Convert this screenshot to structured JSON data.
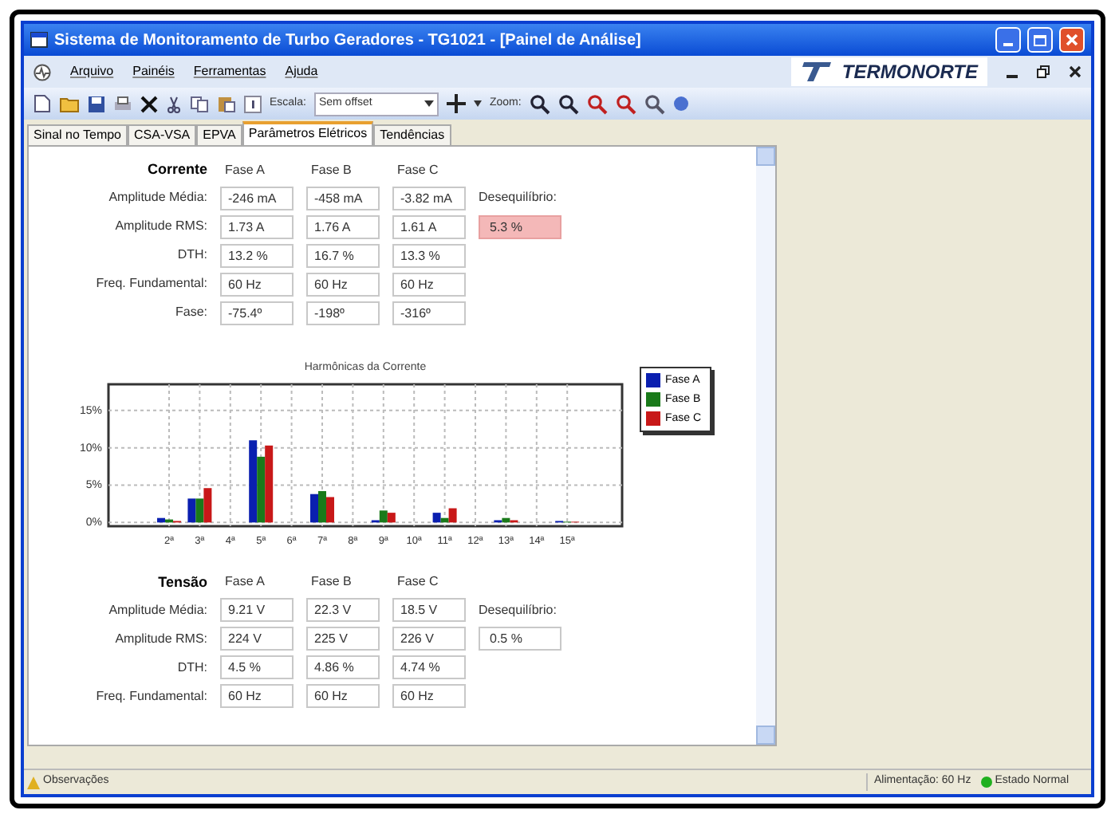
{
  "window": {
    "title": "Sistema de Monitoramento de Turbo Geradores - TG1021 - [Painel de Análise]"
  },
  "menu": [
    "Arquivo",
    "Painéis",
    "Ferramentas",
    "Ajuda"
  ],
  "logo": "TERMONORTE",
  "toolbar": {
    "scale_label": "Escala:",
    "scale_value": "Sem offset",
    "zoom_label": "Zoom:"
  },
  "tabs": [
    {
      "label": "Sinal no Tempo",
      "selected": false
    },
    {
      "label": "CSA-VSA",
      "selected": false
    },
    {
      "label": "EPVA",
      "selected": false
    },
    {
      "label": "Parâmetros Elétricos",
      "selected": true
    },
    {
      "label": "Tendências",
      "selected": false
    }
  ],
  "current": {
    "title": "Corrente",
    "phases": [
      "Fase A",
      "Fase B",
      "Fase C"
    ],
    "rows": [
      {
        "label": "Amplitude Média:",
        "values": [
          "-246 mA",
          "-458 mA",
          "-3.82 mA"
        ]
      },
      {
        "label": "Amplitude RMS:",
        "values": [
          "1.73 A",
          "1.76 A",
          "1.61 A"
        ]
      },
      {
        "label": "DTH:",
        "values": [
          "13.2 %",
          "16.7 %",
          "13.3 %"
        ]
      },
      {
        "label": "Freq. Fundamental:",
        "values": [
          "60 Hz",
          "60 Hz",
          "60 Hz"
        ]
      },
      {
        "label": "Fase:",
        "values": [
          "-75.4º",
          "-198º",
          "-316º"
        ]
      }
    ],
    "imbalance_label": "Desequilíbrio:",
    "imbalance": {
      "value": "5.3 %",
      "alarm": true
    },
    "chart_data": {
      "type": "bar",
      "title": "Harmônicas da Corrente",
      "categories": [
        "2ª",
        "3ª",
        "4ª",
        "5ª",
        "6ª",
        "7ª",
        "8ª",
        "9ª",
        "10ª",
        "11ª",
        "12ª",
        "13ª",
        "14ª",
        "15ª"
      ],
      "series": [
        {
          "name": "Fase A",
          "color": "#0a1fb0",
          "values": [
            0.6,
            3.2,
            0,
            11,
            0,
            3.8,
            0,
            0.3,
            0,
            1.3,
            0,
            0.3,
            0,
            0.2
          ]
        },
        {
          "name": "Fase B",
          "color": "#1a7a1a",
          "values": [
            0.4,
            3.2,
            0,
            8.8,
            0,
            4.2,
            0,
            1.6,
            0,
            0.6,
            0,
            0.6,
            0,
            0.1
          ]
        },
        {
          "name": "Fase C",
          "color": "#c81818",
          "values": [
            0.2,
            4.6,
            0,
            10.3,
            0,
            3.4,
            0,
            1.3,
            0,
            1.9,
            0,
            0.3,
            0,
            0.1
          ]
        }
      ],
      "ylim": [
        -0.5,
        18.5
      ],
      "grid": true,
      "legend": true,
      "yticks": [
        {
          "value": 0,
          "label": "0%"
        },
        {
          "value": 5,
          "label": "5%"
        },
        {
          "value": 10,
          "label": "10%"
        },
        {
          "value": 15,
          "label": "15%"
        }
      ]
    }
  },
  "voltage": {
    "title": "Tensão",
    "phases": [
      "Fase A",
      "Fase B",
      "Fase C"
    ],
    "rows": [
      {
        "label": "Amplitude Média:",
        "values": [
          "9.21 V",
          "22.3 V",
          "18.5 V"
        ]
      },
      {
        "label": "Amplitude RMS:",
        "values": [
          "224 V",
          "225 V",
          "226 V"
        ]
      },
      {
        "label": "DTH:",
        "values": [
          "4.5 %",
          "4.86 %",
          "4.74 %"
        ]
      },
      {
        "label": "Freq. Fundamental:",
        "values": [
          "60 Hz",
          "60 Hz",
          "60 Hz"
        ]
      }
    ],
    "imbalance_label": "Desequilíbrio:",
    "imbalance": {
      "value": "0.5 %",
      "alarm": false
    }
  },
  "status_bar": {
    "notes": "Observações",
    "supply": "Alimentação: 60 Hz",
    "state": {
      "label": "Estado Normal",
      "color": "#20b020"
    }
  }
}
